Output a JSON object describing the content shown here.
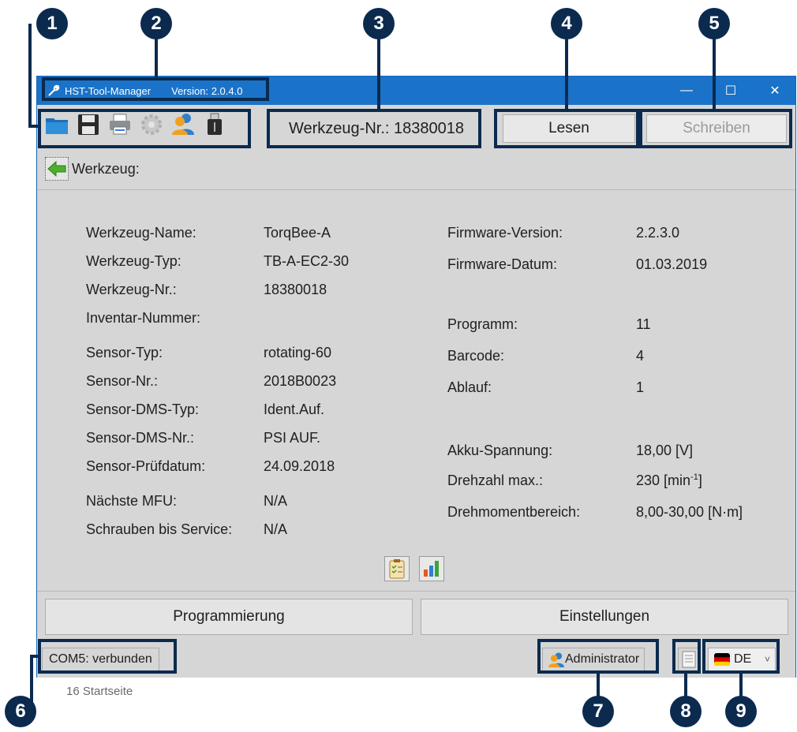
{
  "window": {
    "app_title": "HST-Tool-Manager",
    "version": "Version: 2.0.4.0",
    "minimize": "—",
    "maximize": "☐",
    "close": "✕"
  },
  "toolbar": {
    "icons": [
      "folder-icon",
      "save-icon",
      "print-icon",
      "settings-gear-icon",
      "user-icon",
      "usb-icon"
    ],
    "tool_number": "Werkzeug-Nr.: 18380018",
    "read_label": "Lesen",
    "write_label": "Schreiben"
  },
  "breadcrumb": {
    "label": "Werkzeug:"
  },
  "left_fields": [
    {
      "label": "Werkzeug-Name:",
      "value": "TorqBee-A"
    },
    {
      "label": "Werkzeug-Typ:",
      "value": "TB-A-EC2-30"
    },
    {
      "label": "Werkzeug-Nr.:",
      "value": "18380018"
    },
    {
      "label": "Inventar-Nummer:",
      "value": ""
    },
    {
      "label": "Sensor-Typ:",
      "value": "rotating-60"
    },
    {
      "label": "Sensor-Nr.:",
      "value": "2018B0023"
    },
    {
      "label": "Sensor-DMS-Typ:",
      "value": "Ident.Auf."
    },
    {
      "label": "Sensor-DMS-Nr.:",
      "value": "PSI AUF."
    },
    {
      "label": "Sensor-Prüfdatum:",
      "value": "24.09.2018"
    },
    {
      "label": "Nächste MFU:",
      "value": "N/A"
    },
    {
      "label": "Schrauben bis Service:",
      "value": "N/A"
    }
  ],
  "right_fields": [
    {
      "label": "Firmware-Version:",
      "value": "2.2.3.0"
    },
    {
      "label": "Firmware-Datum:",
      "value": "01.03.2019"
    },
    {
      "label": "Programm:",
      "value": "11"
    },
    {
      "label": "Barcode:",
      "value": "4"
    },
    {
      "label": "Ablauf:",
      "value": "1"
    },
    {
      "label": "Akku-Spannung:",
      "value": "18,00 [V]"
    },
    {
      "label": "Drehzahl max.:",
      "value": "230 [min",
      "sup": "-1",
      "suffix": "]"
    },
    {
      "label": "Drehmomentbereich:",
      "value": "8,00-30,00 [N·m]"
    }
  ],
  "buttons": {
    "programming": "Programmierung",
    "settings": "Einstellungen"
  },
  "status": {
    "connection": "COM5: verbunden",
    "user": "Administrator",
    "language": "DE",
    "language_arrow": "˅"
  },
  "callouts": [
    "1",
    "2",
    "3",
    "4",
    "5",
    "6",
    "7",
    "8",
    "9"
  ],
  "caption": "16 Startseite",
  "colors": {
    "titlebar": "#1a73c9",
    "annotation": "#0b2a4e",
    "window_bg": "#d6d6d6"
  }
}
